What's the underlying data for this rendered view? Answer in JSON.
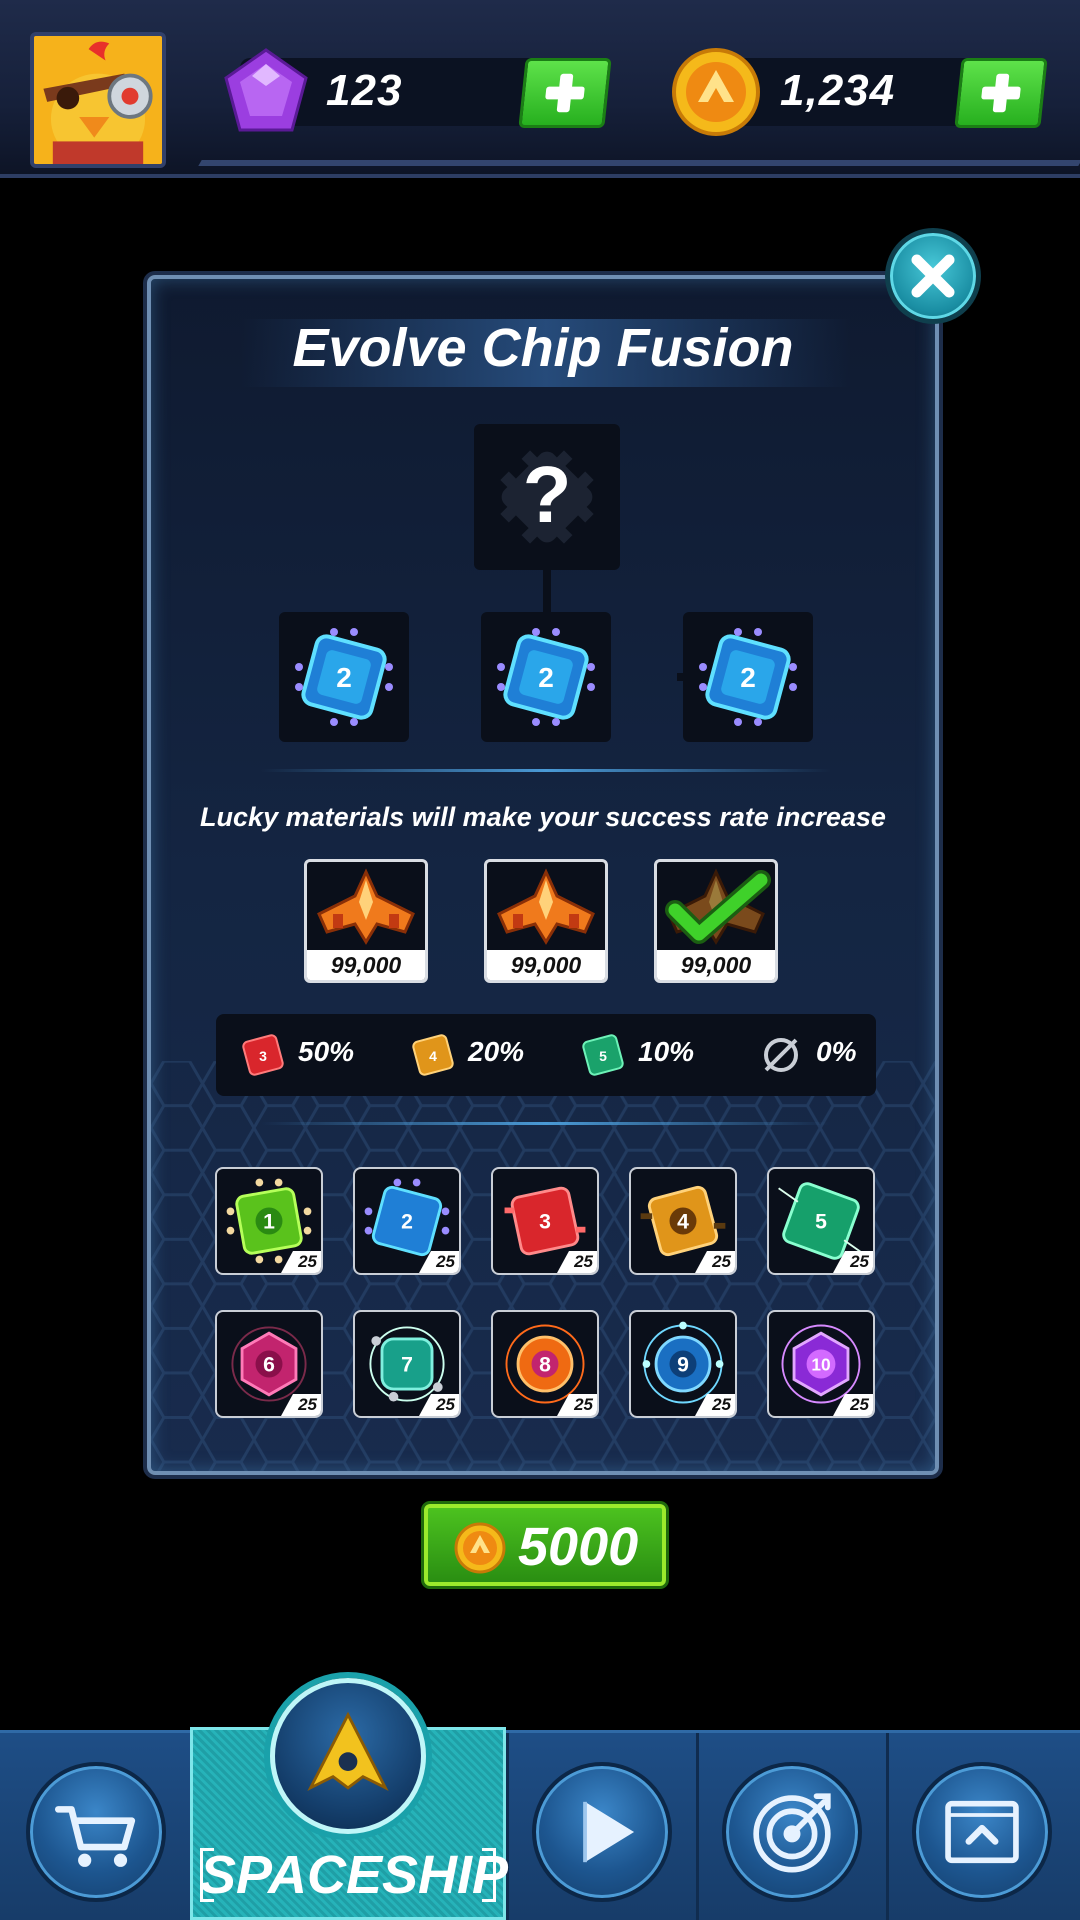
{
  "currencies": {
    "gems": {
      "value": "123",
      "icon": "gem-icon"
    },
    "coins": {
      "value": "1,234",
      "icon": "coin-icon"
    }
  },
  "dialog": {
    "title": "Evolve Chip Fusion",
    "result_slot": "?",
    "input_chips": [
      {
        "level": "2"
      },
      {
        "level": "2"
      },
      {
        "level": "2"
      }
    ],
    "hint": "Lucky materials will make your success rate increase",
    "materials": [
      {
        "price": "99,000",
        "selected": false
      },
      {
        "price": "99,000",
        "selected": false
      },
      {
        "price": "99,000",
        "selected": true
      }
    ],
    "rates": [
      {
        "chip_level": "3",
        "value": "50%"
      },
      {
        "chip_level": "4",
        "value": "20%"
      },
      {
        "chip_level": "5",
        "value": "10%"
      },
      {
        "chip_level": "none",
        "value": "0%"
      }
    ],
    "chip_inventory": [
      {
        "level": "1",
        "count": "25"
      },
      {
        "level": "2",
        "count": "25"
      },
      {
        "level": "3",
        "count": "25"
      },
      {
        "level": "4",
        "count": "25"
      },
      {
        "level": "5",
        "count": "25"
      },
      {
        "level": "6",
        "count": "25"
      },
      {
        "level": "7",
        "count": "25"
      },
      {
        "level": "8",
        "count": "25"
      },
      {
        "level": "9",
        "count": "25"
      },
      {
        "level": "10",
        "count": "25"
      }
    ]
  },
  "fuse_button": {
    "cost": "5000"
  },
  "nav": {
    "active_label": "SPACESHIP",
    "items": [
      "shop",
      "spaceship",
      "play",
      "missions",
      "upgrade"
    ]
  },
  "colors": {
    "accent_green": "#2ea31a",
    "panel_bg": "#142542",
    "nav_active": "#26b3b9"
  }
}
